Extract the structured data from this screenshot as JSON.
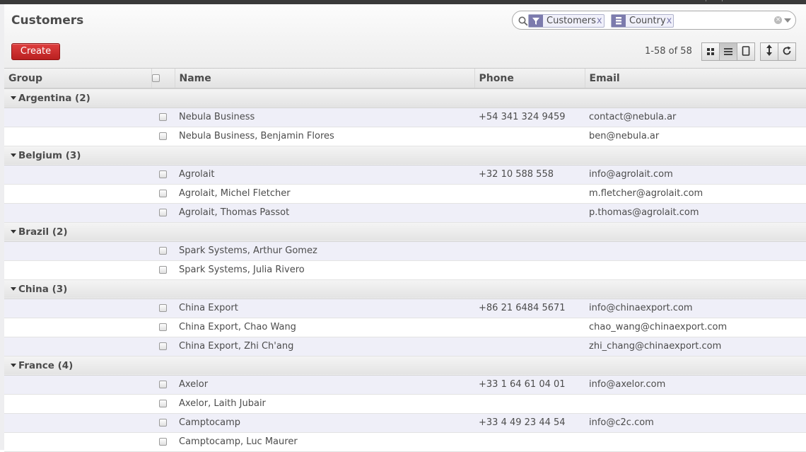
{
  "page": {
    "title": "Customers"
  },
  "toolbar": {
    "create_label": "Create",
    "pager": "1-58 of 58"
  },
  "search": {
    "facets": [
      {
        "icon": "filter-icon",
        "label": "Customers",
        "remove": "x"
      },
      {
        "icon": "group-by-icon",
        "label": "Country",
        "remove": "x"
      }
    ],
    "value": ""
  },
  "view_switcher": [
    "kanban-view-icon",
    "list-view-icon",
    "form-view-icon"
  ],
  "table": {
    "headers": {
      "group": "Group",
      "name": "Name",
      "phone": "Phone",
      "email": "Email"
    },
    "groups": [
      {
        "label": "Argentina (2)",
        "rows": [
          {
            "name": "Nebula Business",
            "phone": "+54 341 324 9459",
            "email": "contact@nebula.ar"
          },
          {
            "name": "Nebula Business, Benjamin Flores",
            "phone": "",
            "email": "ben@nebula.ar"
          }
        ]
      },
      {
        "label": "Belgium (3)",
        "rows": [
          {
            "name": "Agrolait",
            "phone": "+32 10 588 558",
            "email": "info@agrolait.com"
          },
          {
            "name": "Agrolait, Michel Fletcher",
            "phone": "",
            "email": "m.fletcher@agrolait.com"
          },
          {
            "name": "Agrolait, Thomas Passot",
            "phone": "",
            "email": "p.thomas@agrolait.com"
          }
        ]
      },
      {
        "label": "Brazil (2)",
        "rows": [
          {
            "name": "Spark Systems, Arthur Gomez",
            "phone": "",
            "email": ""
          },
          {
            "name": "Spark Systems, Julia Rivero",
            "phone": "",
            "email": ""
          }
        ]
      },
      {
        "label": "China (3)",
        "rows": [
          {
            "name": "China Export",
            "phone": "+86 21 6484 5671",
            "email": "info@chinaexport.com"
          },
          {
            "name": "China Export, Chao Wang",
            "phone": "",
            "email": "chao_wang@chinaexport.com"
          },
          {
            "name": "China Export, Zhi Ch'ang",
            "phone": "",
            "email": "zhi_chang@chinaexport.com"
          }
        ]
      },
      {
        "label": "France (4)",
        "rows": [
          {
            "name": "Axelor",
            "phone": "+33 1 64 61 04 01",
            "email": "info@axelor.com"
          },
          {
            "name": "Axelor, Laith Jubair",
            "phone": "",
            "email": ""
          },
          {
            "name": "Camptocamp",
            "phone": "+33 4 49 23 44 54",
            "email": "info@c2c.com"
          },
          {
            "name": "Camptocamp, Luc Maurer",
            "phone": "",
            "email": ""
          }
        ]
      }
    ]
  },
  "colors": {
    "create_button": "#c42c2c",
    "facet_accent": "#7c7bad",
    "row_stripe": "#efeff8"
  }
}
